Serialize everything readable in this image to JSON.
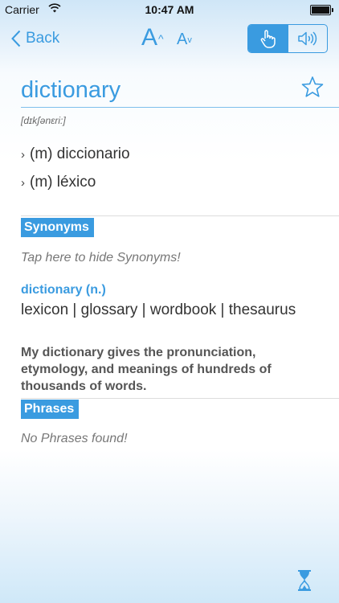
{
  "status": {
    "carrier": "Carrier",
    "time": "10:47 AM"
  },
  "nav": {
    "back_label": "Back",
    "font_increase_label": "A",
    "font_decrease_label": "A",
    "caret": "^"
  },
  "entry": {
    "word": "dictionary",
    "phonetic": "[dɪkʃənɛri:]",
    "translations": [
      "(m) diccionario",
      "(m) léxico"
    ],
    "translation_marker": "›"
  },
  "synonyms": {
    "label": "Synonyms",
    "hint": "Tap here to hide Synonyms!",
    "heading": "dictionary (n.)",
    "list": "lexicon | glossary | wordbook | thesaurus",
    "example": "My dictionary gives the pronunciation, etymology, and meanings of hundreds of thousands of words."
  },
  "phrases": {
    "label": "Phrases",
    "empty": "No Phrases found!"
  },
  "icons": {
    "back": "chevron-left-icon",
    "touch": "hand-pointer-icon",
    "speaker": "speaker-icon",
    "favorite": "star-icon",
    "history": "hourglass-icon"
  },
  "colors": {
    "accent": "#3a9be0",
    "text": "#333333",
    "muted": "#777777"
  }
}
